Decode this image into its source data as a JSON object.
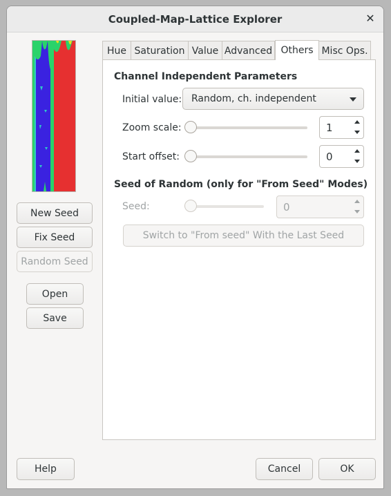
{
  "window": {
    "title": "Coupled-Map-Lattice Explorer",
    "close_glyph": "✕"
  },
  "sidebar": {
    "new_seed": "New Seed",
    "fix_seed": "Fix Seed",
    "random_seed": "Random Seed",
    "open": "Open",
    "save": "Save"
  },
  "tabs": [
    "Hue",
    "Saturation",
    "Value",
    "Advanced",
    "Others",
    "Misc Ops."
  ],
  "active_tab": "Others",
  "others": {
    "section1_heading": "Channel Independent Parameters",
    "initial_value_label": "Initial value:",
    "initial_value_selected": "Random, ch. independent",
    "zoom_scale_label": "Zoom scale:",
    "zoom_scale_value": "1",
    "start_offset_label": "Start offset:",
    "start_offset_value": "0",
    "section2_heading": "Seed of Random (only for \"From Seed\" Modes)",
    "seed_label": "Seed:",
    "seed_value": "0",
    "switch_button": "Switch to \"From seed\" With the Last Seed"
  },
  "footer": {
    "help": "Help",
    "cancel": "Cancel",
    "ok": "OK"
  },
  "colors": {
    "preview_blue": "#3a22e0",
    "preview_red": "#e63030",
    "preview_green": "#2ad36a",
    "preview_yellow": "#e8e020",
    "preview_cyan": "#30c8c8"
  }
}
